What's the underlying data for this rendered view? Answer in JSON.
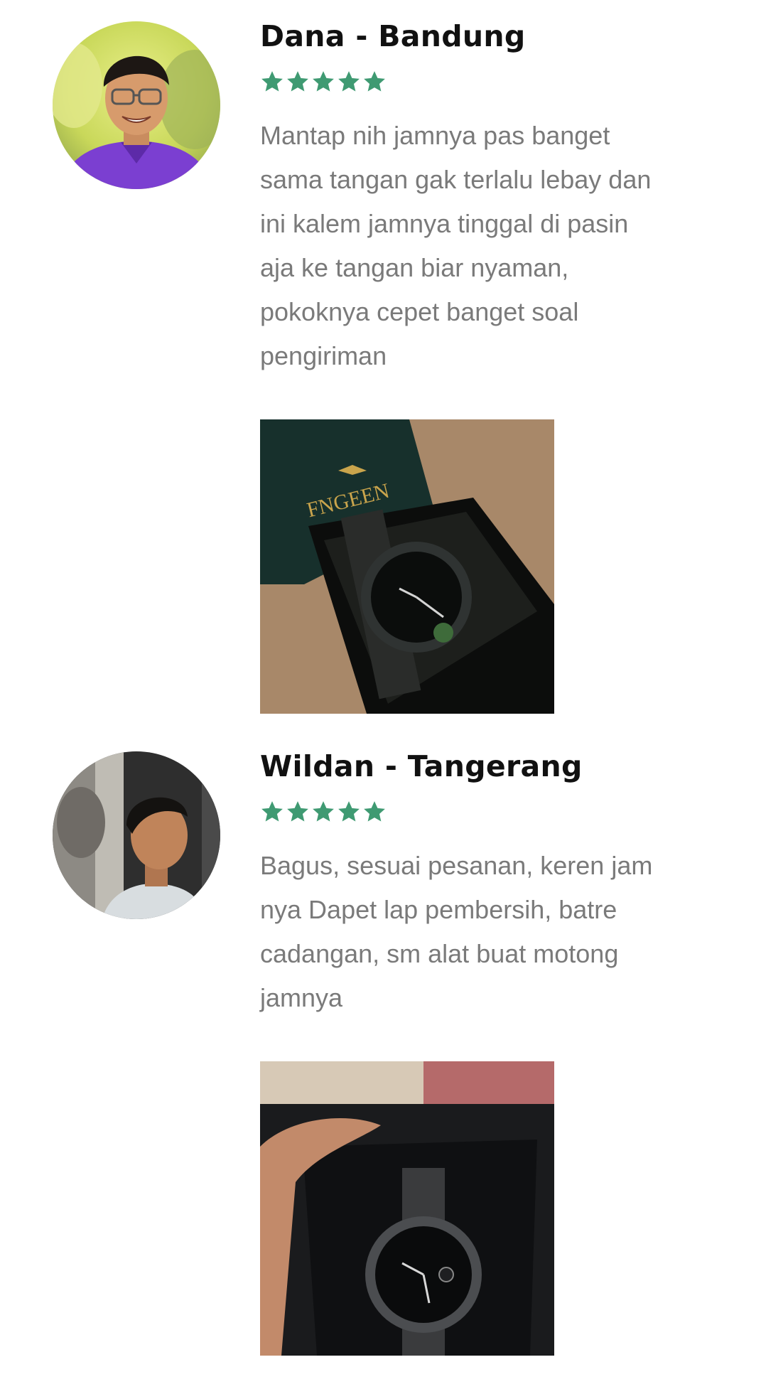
{
  "colors": {
    "star": "#3f9a72",
    "name": "#111111",
    "text": "#7a7a7a"
  },
  "reviews": [
    {
      "name": "Dana - Bandung",
      "rating": 5,
      "text": "Mantap nih jamnya pas banget\nsama tangan gak terlalu lebay dan\nini kalem jamnya tinggal di pasin\naja ke tangan biar nyaman,\npokoknya cepet banget soal\npengiriman",
      "photo_brand": "FNGEEN"
    },
    {
      "name": "Wildan - Tangerang",
      "rating": 5,
      "text": "Bagus, sesuai pesanan, keren jam\nnya Dapet lap pembersih, batre\ncadangan, sm alat buat motong\njamnya"
    }
  ]
}
